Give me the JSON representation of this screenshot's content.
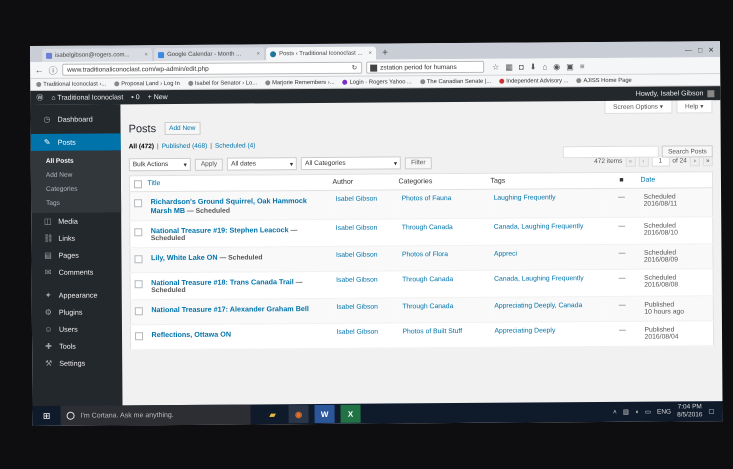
{
  "browser": {
    "tabs": [
      {
        "label": "isabelgibson@rogers.com...",
        "color": "#6b7fd7",
        "active": false
      },
      {
        "label": "Google Calendar - Month ...",
        "color": "#3b8ae0",
        "active": false
      },
      {
        "label": "Posts ‹ Traditional Iconoclast ...",
        "color": "#21759b",
        "active": true
      }
    ],
    "new_tab": "+",
    "url": "www.traditionaliconoclast.com/wp-admin/edit.php",
    "search_text": "zstation period for humans",
    "bookmarks": [
      "Traditional Iconoclast ›...",
      "Proposal Land › Log In",
      "Isabel for Senator › Lo...",
      "Marjorie Remembers ›...",
      "Login - Rogers Yahoo ...",
      "The Canadian Senate |...",
      "Independent Advisory ...",
      "AJISS Home Page"
    ]
  },
  "adminbar": {
    "site": "Traditional Iconoclast",
    "comments": "0",
    "new": "New",
    "howdy": "Howdy, Isabel Gibson"
  },
  "sidebar": {
    "items": [
      {
        "label": "Dashboard",
        "icon": "◷"
      },
      {
        "label": "Posts",
        "icon": "✎"
      }
    ],
    "sub": [
      "All Posts",
      "Add New",
      "Categories",
      "Tags"
    ],
    "rest": [
      {
        "label": "Media",
        "icon": "◫"
      },
      {
        "label": "Links",
        "icon": "⛓"
      },
      {
        "label": "Pages",
        "icon": "▤"
      },
      {
        "label": "Comments",
        "icon": "✉"
      },
      {
        "label": "Appearance",
        "icon": "✦"
      },
      {
        "label": "Plugins",
        "icon": "⚙"
      },
      {
        "label": "Users",
        "icon": "☺"
      },
      {
        "label": "Tools",
        "icon": "✚"
      },
      {
        "label": "Settings",
        "icon": "⚒"
      }
    ]
  },
  "page": {
    "screen_options": "Screen Options ▾",
    "help": "Help ▾",
    "title": "Posts",
    "add_new": "Add New",
    "filter_all": "All (472)",
    "filter_published": "Published (468)",
    "filter_scheduled": "Scheduled (4)",
    "sep": "|",
    "search_button": "Search Posts",
    "bulk": "Bulk Actions",
    "apply": "Apply",
    "dates": "All dates",
    "categories": "All Categories",
    "filter": "Filter",
    "items": "472 items",
    "first": "«",
    "prev": "‹",
    "page_no": "1",
    "of_pages": "of 24",
    "next": "›",
    "last": "»"
  },
  "table": {
    "headers": {
      "title": "Title",
      "author": "Author",
      "categories": "Categories",
      "tags": "Tags",
      "comments": "■",
      "date": "Date"
    },
    "rows": [
      {
        "title": "Richardson's Ground Squirrel, Oak Hammock Marsh MB",
        "state": " — Scheduled",
        "author": "Isabel Gibson",
        "categories": "Photos of Fauna",
        "tags": "Laughing Frequently",
        "comments": "—",
        "status": "Scheduled",
        "date": "2016/08/11"
      },
      {
        "title": "National Treasure #19: Stephen Leacock",
        "state": " — Scheduled",
        "author": "Isabel Gibson",
        "categories": "Through Canada",
        "tags": "Canada, Laughing Frequently",
        "comments": "—",
        "status": "Scheduled",
        "date": "2016/08/10"
      },
      {
        "title": "Lily, White Lake ON",
        "state": " — Scheduled",
        "author": "Isabel Gibson",
        "categories": "Photos of Flora",
        "tags": "Appreci",
        "comments": "—",
        "status": "Scheduled",
        "date": "2016/08/09"
      },
      {
        "title": "National Treasure #18: Trans Canada Trail",
        "state": " — Scheduled",
        "author": "Isabel Gibson",
        "categories": "Through Canada",
        "tags": "Canada, Laughing Frequently",
        "comments": "—",
        "status": "Scheduled",
        "date": "2016/08/08"
      },
      {
        "title": "National Treasure #17: Alexander Graham Bell",
        "state": "",
        "author": "Isabel Gibson",
        "categories": "Through Canada",
        "tags": "Appreciating Deeply, Canada",
        "comments": "—",
        "status": "Published",
        "date": "10 hours ago"
      },
      {
        "title": "Reflections, Ottawa ON",
        "state": "",
        "author": "Isabel Gibson",
        "categories": "Photos of Built Stuff",
        "tags": "Appreciating Deeply",
        "comments": "—",
        "status": "Published",
        "date": "2016/08/04"
      }
    ]
  },
  "taskbar": {
    "cortana": "I'm Cortana. Ask me anything.",
    "lang": "ENG",
    "time": "7:04 PM",
    "date": "8/5/2016",
    "apps": [
      "▰",
      "◉",
      "W",
      "X"
    ]
  }
}
